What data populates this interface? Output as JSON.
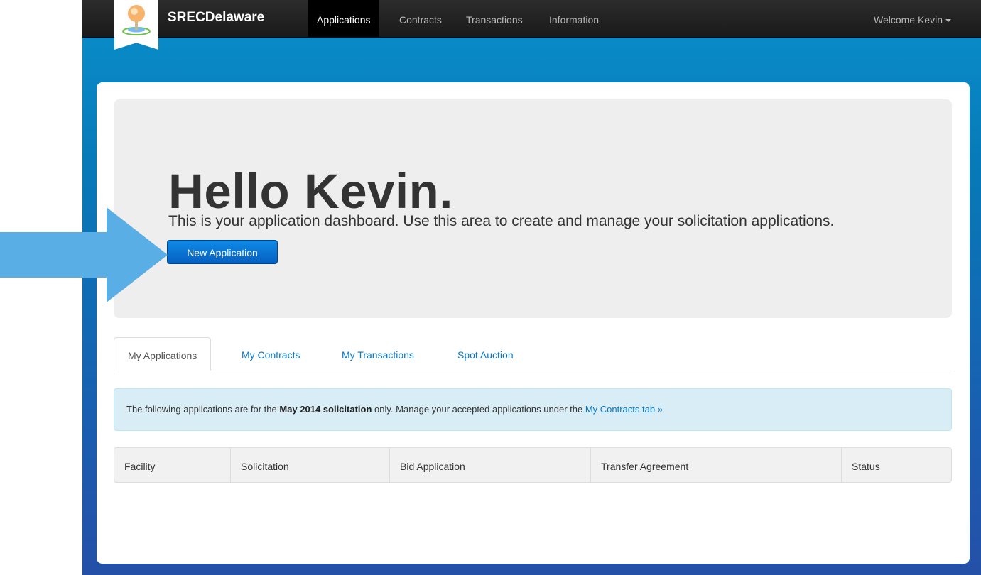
{
  "navbar": {
    "brand": "SRECDelaware",
    "items": [
      {
        "label": "Applications",
        "active": true
      },
      {
        "label": "Contracts",
        "active": false
      },
      {
        "label": "Transactions",
        "active": false
      },
      {
        "label": "Information",
        "active": false
      }
    ],
    "welcome": "Welcome Kevin"
  },
  "hero": {
    "title": "Hello Kevin.",
    "subtitle": "This is your application dashboard. Use this area to create and manage your solicitation applications.",
    "button_label": "New Application"
  },
  "tabs": [
    {
      "label": "My Applications",
      "active": true
    },
    {
      "label": "My Contracts",
      "active": false
    },
    {
      "label": "My Transactions",
      "active": false
    },
    {
      "label": "Spot Auction",
      "active": false
    }
  ],
  "alert": {
    "text_before": "The following applications are for the ",
    "bold": "May 2014 solicitation",
    "text_after": " only. Manage your accepted applications under the ",
    "link": "My Contracts tab »"
  },
  "table": {
    "headers": [
      "Facility",
      "Solicitation",
      "Bid Application",
      "Transfer Agreement",
      "Status"
    ]
  },
  "colors": {
    "accent": "#0a78c6",
    "navbar": "#1a1a1a",
    "hero_bg": "#eeeeee",
    "alert_bg": "#d9edf7",
    "arrow": "#5aaee6"
  }
}
